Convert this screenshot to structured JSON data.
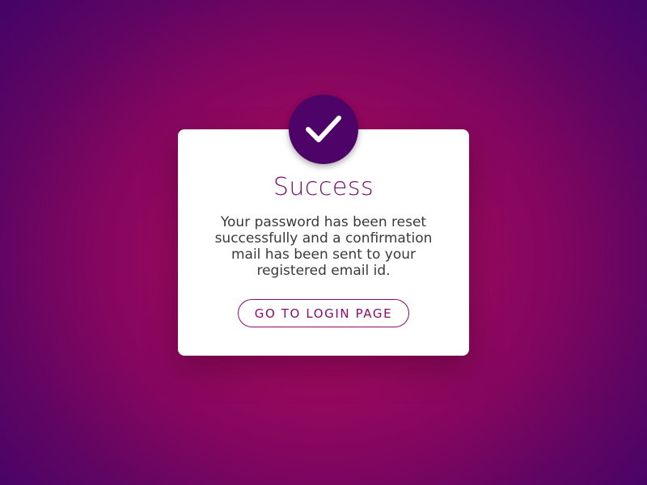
{
  "dialog": {
    "title": "Success",
    "message": "Your password has been reset successfully and a confirmation mail has been sent to your registered email id.",
    "button_label": "GO TO LOGIN PAGE",
    "icon": "checkmark-icon"
  },
  "colors": {
    "background_center": "#b3075c",
    "background_edge": "#470467",
    "badge": "#4d0368",
    "title": "#7b0a6e",
    "button": "#8e0a6a",
    "card": "#ffffff",
    "text": "#3a3a3a"
  }
}
